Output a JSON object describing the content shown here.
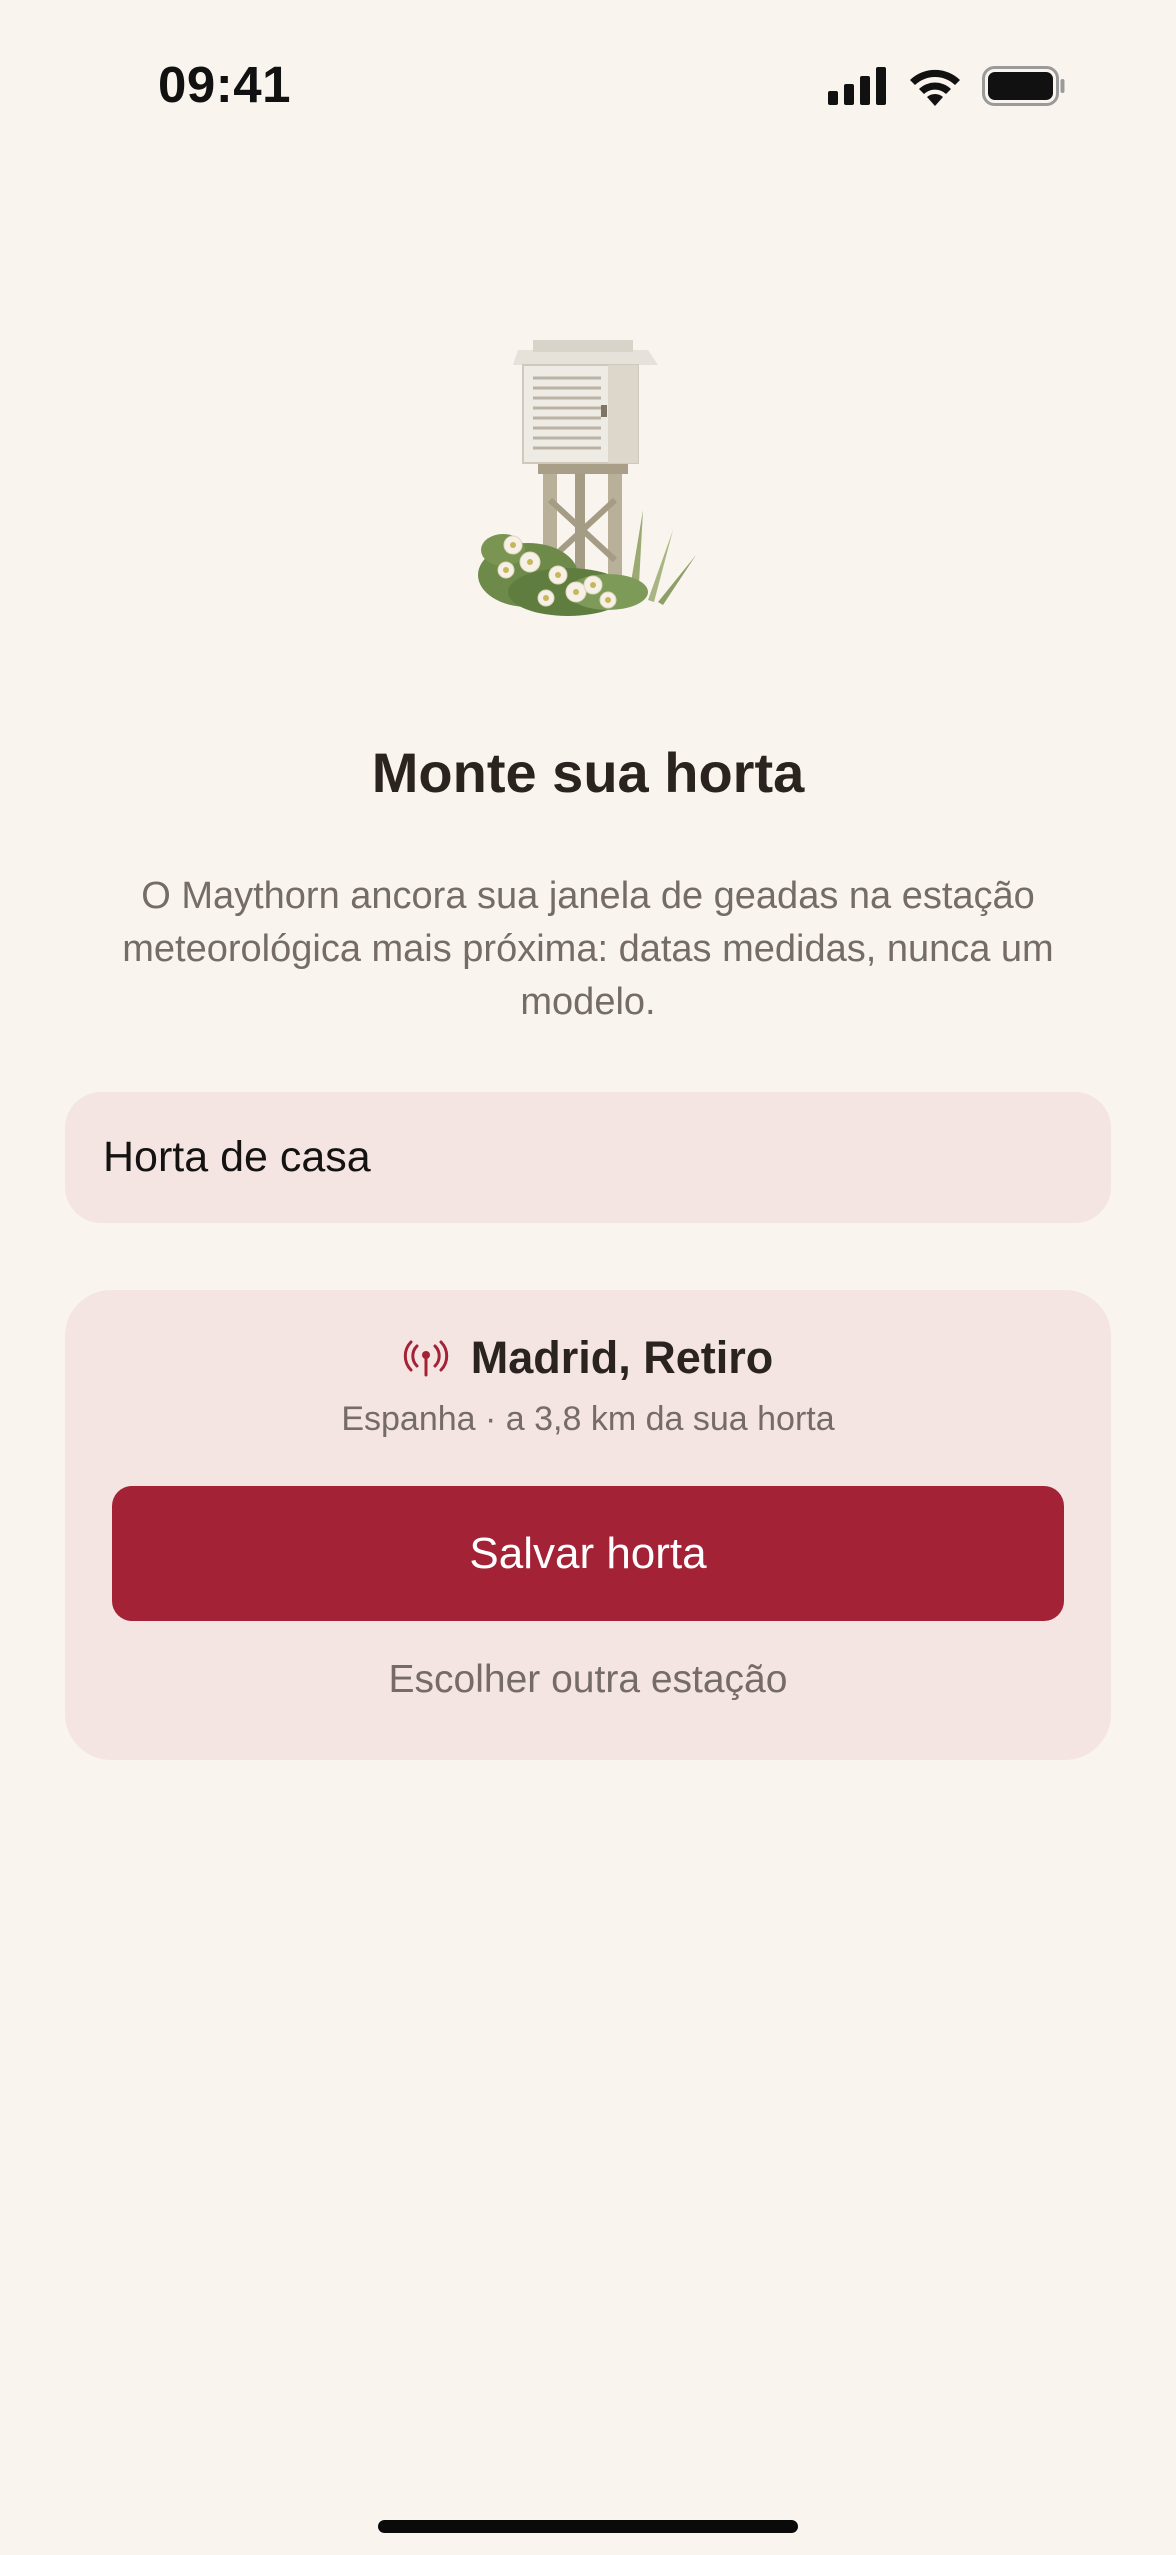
{
  "status_bar": {
    "time": "09:41",
    "icons": [
      "cellular-signal-icon",
      "wifi-icon",
      "battery-icon"
    ]
  },
  "hero": {
    "icon": "weather-station-illustration"
  },
  "header": {
    "title": "Monte sua horta",
    "subtitle": "O Maythorn ancora sua janela de geadas na estação meteorológica mais próxima: datas medidas, nunca um modelo."
  },
  "form": {
    "garden_name_value": "Horta de casa"
  },
  "station": {
    "icon": "antenna-icon",
    "name": "Madrid, Retiro",
    "meta": "Espanha · a 3,8 km da sua horta",
    "save_label": "Salvar horta",
    "choose_other_label": "Escolher outra estação"
  },
  "colors": {
    "background": "#f9f4ee",
    "card": "#f4e5e3",
    "accent": "#a32236",
    "text_primary": "#2a231f",
    "text_secondary": "#756c66"
  }
}
